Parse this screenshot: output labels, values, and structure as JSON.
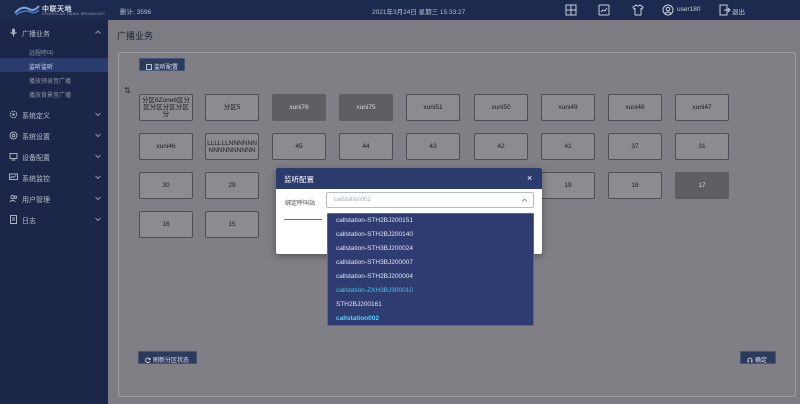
{
  "topbar": {
    "logo_text": "中联天地",
    "logo_sub": "ZHONGLIAN TIANDI BROADCAST",
    "counter": "删计: 3596",
    "date": "2021年3月24日    星期三    15:33:27",
    "user": "user180",
    "logout": "退出",
    "icons": [
      "grid-icon",
      "chart-icon",
      "shirt-icon",
      "user-circle-icon",
      "logout-icon"
    ]
  },
  "sidebar": {
    "items": [
      {
        "label": "广播业务",
        "icon": "mic-icon",
        "expanded": true
      },
      {
        "label": "系统定义",
        "icon": "gear-icon"
      },
      {
        "label": "系统设置",
        "icon": "settings-icon"
      },
      {
        "label": "设备配置",
        "icon": "device-icon"
      },
      {
        "label": "系统监控",
        "icon": "monitor-icon"
      },
      {
        "label": "用户管理",
        "icon": "users-icon"
      },
      {
        "label": "日志",
        "icon": "log-icon"
      }
    ],
    "subitems": [
      {
        "label": "远程呼叫"
      },
      {
        "label": "监听监听",
        "active": true
      },
      {
        "label": "播放预录音广播"
      },
      {
        "label": "播放背景音广播"
      }
    ]
  },
  "main": {
    "title": "广播业务",
    "monitor_button": "监听配置",
    "refresh_button": "刷新分区状态",
    "confirm_button": "确定",
    "tiles": [
      {
        "label": "分区6Zone6区分区分区分区分区分",
        "state": "normal"
      },
      {
        "label": "分区5",
        "state": "normal"
      },
      {
        "label": "xuni76",
        "state": "disabled"
      },
      {
        "label": "xuni75",
        "state": "disabled"
      },
      {
        "label": "xuni51",
        "state": "normal"
      },
      {
        "label": "xuni50",
        "state": "normal"
      },
      {
        "label": "xuni49",
        "state": "normal"
      },
      {
        "label": "xuni48",
        "state": "normal"
      },
      {
        "label": "xuni47",
        "state": "normal"
      },
      {
        "label": "xuni46",
        "state": "normal"
      },
      {
        "label": "LLLLLLNNNNNNNNNNNNNNNN",
        "state": "normal"
      },
      {
        "label": "45",
        "state": "normal"
      },
      {
        "label": "44",
        "state": "normal"
      },
      {
        "label": "43",
        "state": "normal"
      },
      {
        "label": "42",
        "state": "normal"
      },
      {
        "label": "41",
        "state": "normal"
      },
      {
        "label": "37",
        "state": "normal"
      },
      {
        "label": "31",
        "state": "normal"
      },
      {
        "label": "30",
        "state": "normal"
      },
      {
        "label": "29",
        "state": "normal"
      },
      {
        "label": "19",
        "state": "normal"
      },
      {
        "label": "18",
        "state": "normal"
      },
      {
        "label": "17",
        "state": "disabled"
      },
      {
        "label": "16",
        "state": "normal"
      },
      {
        "label": "15",
        "state": "normal"
      }
    ]
  },
  "modal": {
    "title": "监听配置",
    "close": "×",
    "field_label": "绑定呼叫站",
    "select_value": "callstation002",
    "options": [
      {
        "label": "callstation-STH2BJ200151"
      },
      {
        "label": "callstation-STH2BJ200140"
      },
      {
        "label": "callstation-STH3BJ200024"
      },
      {
        "label": "callstation-STH3BJ200007"
      },
      {
        "label": "callstation-STH2BJ200004"
      },
      {
        "label": "callstation-ZXH3BJ300010",
        "highlight": true
      },
      {
        "label": "STH2BJ200161"
      },
      {
        "label": "callstation002",
        "selected": true
      }
    ]
  },
  "colors": {
    "topbar": "#1c2a4f",
    "sidebar": "#1b2648",
    "modal_header": "#2b3b6e",
    "dropdown_bg": "#2e3c72",
    "highlight": "#3fc7e6"
  }
}
